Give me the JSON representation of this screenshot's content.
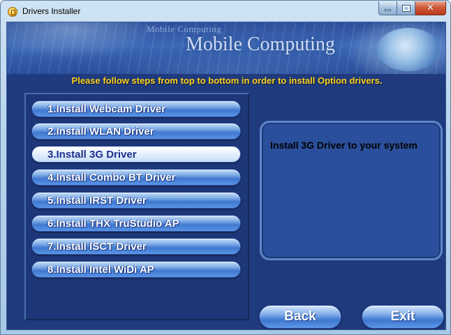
{
  "window": {
    "title": "Drivers Installer"
  },
  "banner": {
    "small_text": "Mobile Computing",
    "title": "Mobile Computing"
  },
  "instruction": "Please follow steps from top to bottom in order to install Option drivers.",
  "steps": [
    {
      "label": "1.Install Webcam Driver",
      "state": "normal"
    },
    {
      "label": "2.Install WLAN Driver",
      "state": "normal"
    },
    {
      "label": "3.Install 3G Driver",
      "state": "selected"
    },
    {
      "label": "4.Install Combo BT Driver",
      "state": "normal"
    },
    {
      "label": "5.Install IRST Driver",
      "state": "normal"
    },
    {
      "label": "6.Install THX TruStudio AP",
      "state": "normal"
    },
    {
      "label": "7.Install ISCT Driver",
      "state": "normal"
    },
    {
      "label": "8.Install Intel WiDi AP",
      "state": "normal"
    }
  ],
  "info": {
    "text": "Install 3G Driver to your system"
  },
  "buttons": {
    "back": "Back",
    "exit": "Exit"
  },
  "colors": {
    "instruction_text": "#ffd21a",
    "client_background": "#1f3a7d"
  }
}
